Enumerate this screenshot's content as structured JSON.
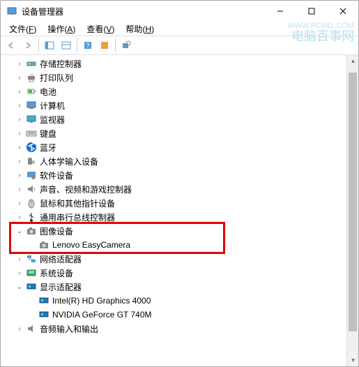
{
  "window": {
    "title": "设备管理器"
  },
  "menu": {
    "file": {
      "label": "文件",
      "key": "F"
    },
    "action": {
      "label": "操作",
      "key": "A"
    },
    "view": {
      "label": "查看",
      "key": "V"
    },
    "help": {
      "label": "帮助",
      "key": "H"
    }
  },
  "watermark": {
    "url": "WWW.PC841.COM",
    "cn": "电脑百事网"
  },
  "tree": {
    "items": [
      {
        "label": "存储控制器",
        "icon": "storage",
        "level": 1,
        "exp": "right"
      },
      {
        "label": "打印队列",
        "icon": "printer",
        "level": 1,
        "exp": "right"
      },
      {
        "label": "电池",
        "icon": "battery",
        "level": 1,
        "exp": "right"
      },
      {
        "label": "计算机",
        "icon": "computer",
        "level": 1,
        "exp": "right"
      },
      {
        "label": "监视器",
        "icon": "monitor",
        "level": 1,
        "exp": "right"
      },
      {
        "label": "键盘",
        "icon": "keyboard",
        "level": 1,
        "exp": "right"
      },
      {
        "label": "蓝牙",
        "icon": "bluetooth",
        "level": 1,
        "exp": "right"
      },
      {
        "label": "人体学输入设备",
        "icon": "hid",
        "level": 1,
        "exp": "right"
      },
      {
        "label": "软件设备",
        "icon": "software",
        "level": 1,
        "exp": "right"
      },
      {
        "label": "声音、视频和游戏控制器",
        "icon": "sound",
        "level": 1,
        "exp": "right"
      },
      {
        "label": "鼠标和其他指针设备",
        "icon": "mouse",
        "level": 1,
        "exp": "right"
      },
      {
        "label": "通用串行总线控制器",
        "icon": "usb",
        "level": 1,
        "exp": "right"
      },
      {
        "label": "图像设备",
        "icon": "camera",
        "level": 1,
        "exp": "down",
        "highlight": true
      },
      {
        "label": "Lenovo EasyCamera",
        "icon": "camera",
        "level": 2,
        "exp": "none",
        "highlight": true
      },
      {
        "label": "网络适配器",
        "icon": "network",
        "level": 1,
        "exp": "right"
      },
      {
        "label": "系统设备",
        "icon": "system",
        "level": 1,
        "exp": "right"
      },
      {
        "label": "显示适配器",
        "icon": "display",
        "level": 1,
        "exp": "down"
      },
      {
        "label": "Intel(R) HD Graphics 4000",
        "icon": "display",
        "level": 2,
        "exp": "none"
      },
      {
        "label": "NVIDIA GeForce GT 740M",
        "icon": "display",
        "level": 2,
        "exp": "none"
      },
      {
        "label": "音频输入和输出",
        "icon": "audio",
        "level": 1,
        "exp": "right"
      }
    ]
  }
}
